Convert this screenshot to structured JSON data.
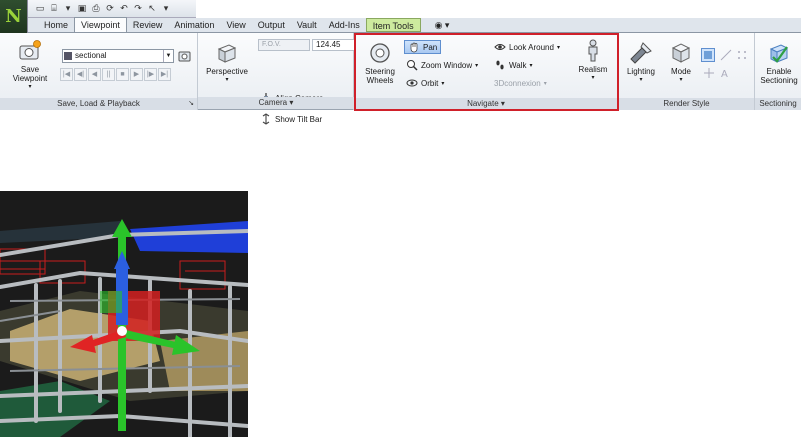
{
  "app": {
    "logo": "N"
  },
  "qat": {
    "icons": [
      "new-icon",
      "open-icon",
      "dropdown-icon",
      "save-icon",
      "print-icon",
      "refresh-icon",
      "undo-icon",
      "redo-icon",
      "select-icon",
      "more-icon"
    ]
  },
  "tabs": [
    {
      "label": "Home",
      "active": false
    },
    {
      "label": "Viewpoint",
      "active": true
    },
    {
      "label": "Review",
      "active": false
    },
    {
      "label": "Animation",
      "active": false
    },
    {
      "label": "View",
      "active": false
    },
    {
      "label": "Output",
      "active": false
    },
    {
      "label": "Vault",
      "active": false
    },
    {
      "label": "Add-Ins",
      "active": false
    },
    {
      "label": "Item Tools",
      "active": false,
      "contextual": true
    },
    {
      "label": "◉ ▾",
      "active": false
    }
  ],
  "ribbon": {
    "save_load": {
      "title": "Save, Load & Playback",
      "save_viewpoint": "Save\nViewpoint",
      "viewpoint_combo": "sectional"
    },
    "camera": {
      "title": "Camera",
      "perspective": "Perspective",
      "fov_label": "F.O.V.",
      "fov_value": "124.45",
      "align_camera": "Align Camera",
      "show_tilt_bar": "Show Tilt Bar"
    },
    "navigate": {
      "title": "Navigate",
      "steering_wheels": "Steering\nWheels",
      "pan": "Pan",
      "zoom_window": "Zoom Window",
      "orbit": "Orbit",
      "look_around": "Look Around",
      "walk": "Walk",
      "connexion": "3Dconnexion",
      "realism": "Realism"
    },
    "render_style": {
      "title": "Render Style",
      "lighting": "Lighting",
      "mode": "Mode"
    },
    "sectioning": {
      "title": "Sectioning",
      "enable": "Enable\nSectioning"
    }
  },
  "colors": {
    "highlight_box": "#d0202a",
    "gizmo_x": "#e02020",
    "gizmo_y": "#20c020",
    "gizmo_z": "#2060e0"
  }
}
